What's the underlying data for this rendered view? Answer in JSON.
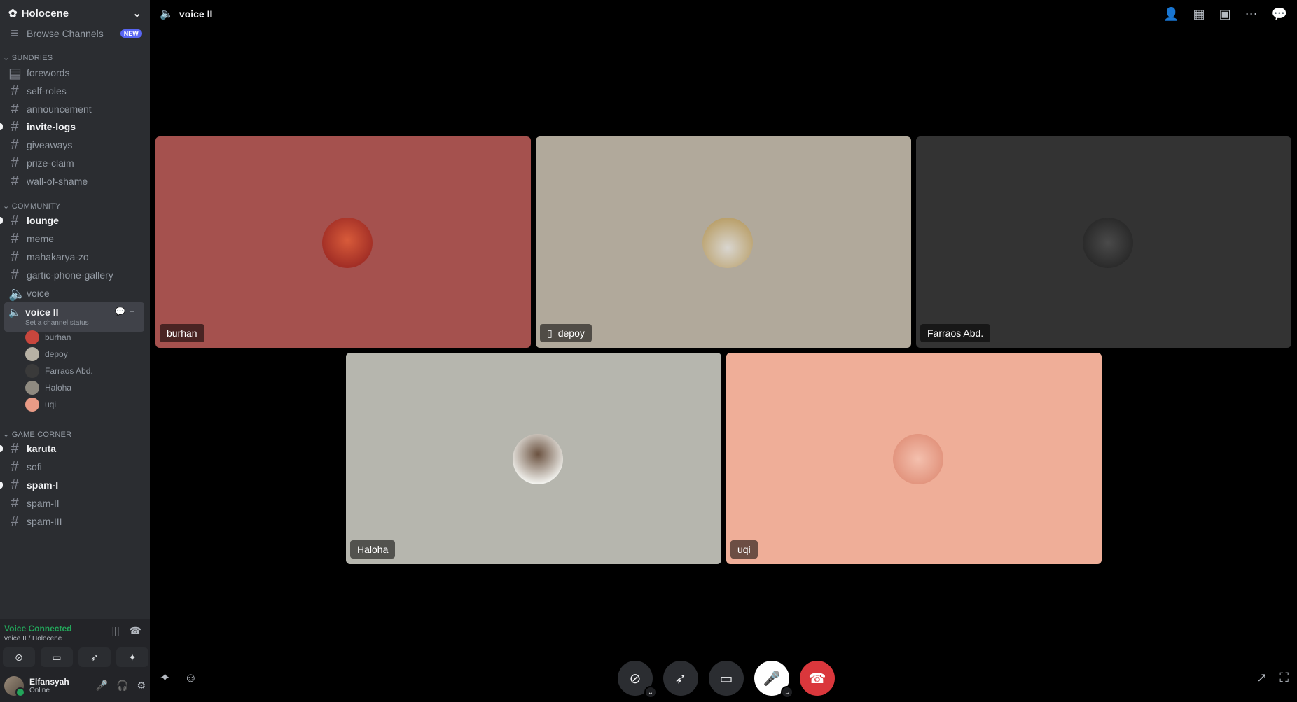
{
  "server": {
    "name": "Holocene"
  },
  "browse": {
    "label": "Browse Channels",
    "badge": "NEW"
  },
  "categories": {
    "sundries": "SUNDRIES",
    "community": "COMMUNITY",
    "game_corner": "GAME CORNER"
  },
  "sundries_channels": [
    "forewords",
    "self-roles",
    "announcement",
    "invite-logs",
    "giveaways",
    "prize-claim",
    "wall-of-shame"
  ],
  "community_channels": [
    "lounge",
    "meme",
    "mahakarya-zo",
    "gartic-phone-gallery",
    "voice"
  ],
  "active_voice": {
    "name": "voice II",
    "status_hint": "Set a channel status"
  },
  "voice_members": [
    "burhan",
    "depoy",
    "Farraos Abd.",
    "Haloha",
    "uqi"
  ],
  "game_channels": [
    "karuta",
    "sofi",
    "spam-I",
    "spam-II",
    "spam-III"
  ],
  "voice_panel": {
    "status": "Voice Connected",
    "location": "voice II / Holocene"
  },
  "user": {
    "name": "Elfansyah",
    "status": "Online"
  },
  "topbar": {
    "title": "voice II"
  },
  "tiles": [
    {
      "name": "burhan",
      "color": "#a5514e"
    },
    {
      "name": "depoy",
      "color": "#b1a99b"
    },
    {
      "name": "Farraos Abd.",
      "color": "#333333"
    },
    {
      "name": "Haloha",
      "color": "#b6b6ae"
    },
    {
      "name": "uqi",
      "color": "#efae98"
    }
  ],
  "icons": {
    "server": "gear-icon",
    "speaker": "speaker-icon",
    "hash": "hash-icon",
    "camera_off": "camera-off-icon",
    "activity": "rocket-icon",
    "screen": "screen-share-icon",
    "mic": "microphone-icon",
    "hangup": "phone-hangup-icon",
    "phone": "phone-icon"
  }
}
